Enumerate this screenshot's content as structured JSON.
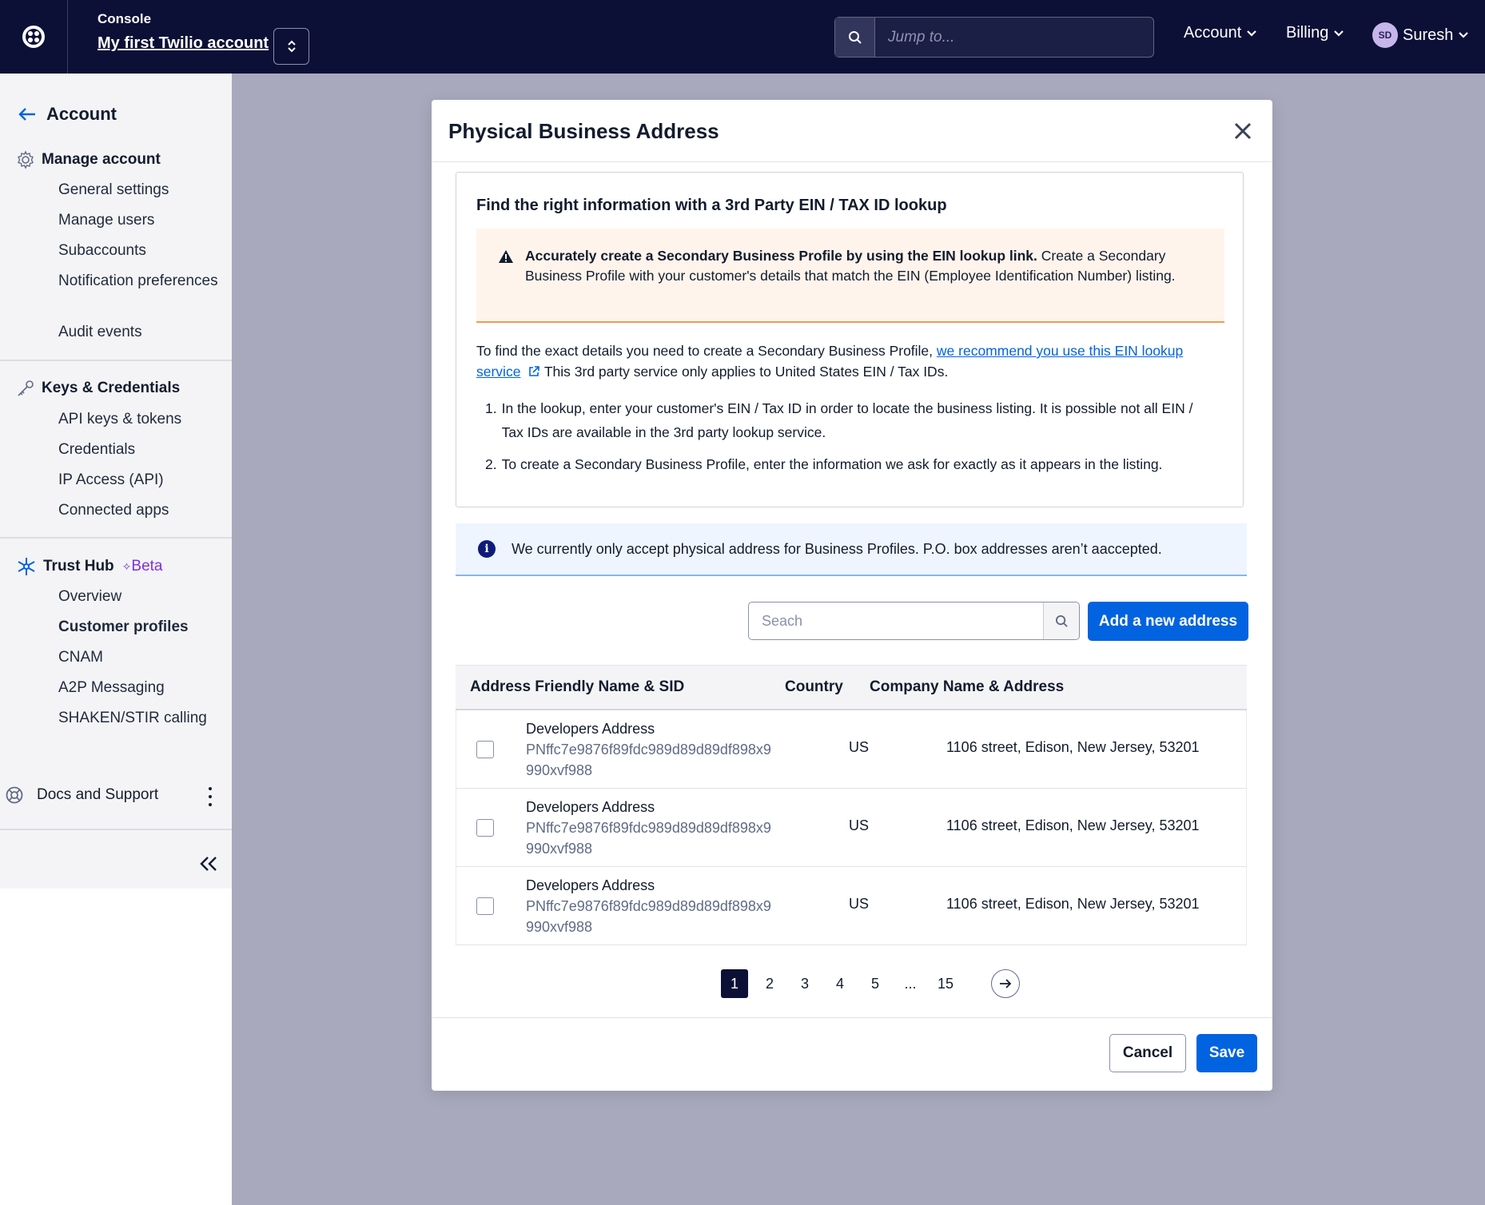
{
  "topbar": {
    "console_label": "Console",
    "account_name": "My first Twilio account",
    "search_placeholder": "Jump to...",
    "nav_account": "Account",
    "nav_billing": "Billing",
    "avatar_initials": "SD",
    "user_name": "Suresh"
  },
  "sidebar": {
    "back_label": "Account",
    "sections": [
      {
        "title": "Manage account",
        "items": [
          "General settings",
          "Manage users",
          "Subaccounts",
          "Notification preferences",
          "Audit events"
        ]
      },
      {
        "title": "Keys & Credentials",
        "items": [
          "API keys & tokens",
          "Credentials",
          "IP Access (API)",
          "Connected apps"
        ]
      },
      {
        "title": "Trust Hub",
        "badge": "Beta",
        "items": [
          "Overview",
          "Customer profiles",
          "CNAM",
          "A2P Messaging",
          "SHAKEN/STIR calling"
        ],
        "active_item": "Customer profiles"
      }
    ],
    "docs_support": "Docs and Support"
  },
  "modal": {
    "title": "Physical Business Address",
    "lookup": {
      "title": "Find the right information with a 3rd Party EIN / TAX ID lookup",
      "warning_bold": "Accurately create a Secondary Business Profile by using the EIN lookup link.",
      "warning_rest": " Create a Secondary Business Profile with your customer's details that match the EIN (Employee Identification Number) listing.",
      "body_prefix": "To find the exact details you need to create a Secondary Business Profile, ",
      "body_link": "we recommend you use this EIN lookup service",
      "body_suffix": " This 3rd party service only applies to United States EIN / Tax IDs.",
      "steps": [
        "In the lookup, enter your customer's EIN / Tax ID in order to locate the business listing. It is possible not all EIN / Tax IDs are available in the 3rd party lookup service.",
        "To create a Secondary Business Profile, enter the information we ask for exactly as it appears in the listing."
      ]
    },
    "info_text": "We currently only accept physical address for Business Profiles. P.O. box addresses aren’t aaccepted.",
    "search_placeholder": "Seach",
    "add_button": "Add a new address",
    "table": {
      "headers": [
        "Address Friendly Name & SID",
        "Country",
        "Company Name & Address"
      ],
      "rows": [
        {
          "name": "Developers Address",
          "sid": "PNffc7e9876f89fdc989d89d89df898x9 990xvf988",
          "country": "US",
          "address": "1106 street, Edison, New Jersey, 53201"
        },
        {
          "name": "Developers Address",
          "sid": "PNffc7e9876f89fdc989d89d89df898x9 990xvf988",
          "country": "US",
          "address": "1106 street, Edison, New Jersey, 53201"
        },
        {
          "name": "Developers Address",
          "sid": "PNffc7e9876f89fdc989d89d89df898x9 990xvf988",
          "country": "US",
          "address": "1106 street, Edison, New Jersey, 53201"
        }
      ]
    },
    "pagination": {
      "pages": [
        "1",
        "2",
        "3",
        "4",
        "5",
        "...",
        "15"
      ],
      "current": "1"
    },
    "cancel_button": "Cancel",
    "save_button": "Save"
  },
  "colors": {
    "brand_navy": "#0d1036",
    "primary_blue": "#0263e0",
    "warning_bg": "#fff4ec",
    "warning_border": "#f39a53",
    "info_bg": "#eef5ff",
    "beta_purple": "#7e32d9"
  }
}
